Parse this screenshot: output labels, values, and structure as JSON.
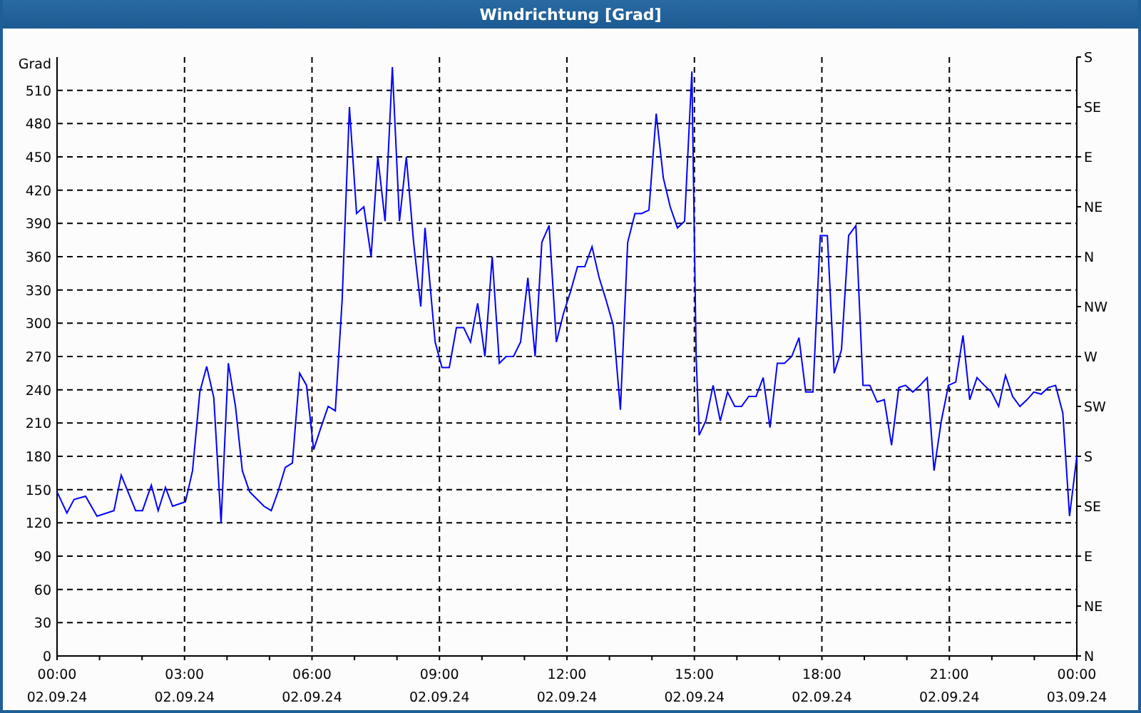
{
  "window": {
    "title": "Windrichtung [Grad]"
  },
  "chart": {
    "chart_data": {
      "type": "line",
      "grid": true,
      "ylabel": "Grad",
      "xlim": [
        0,
        24
      ],
      "ylim": [
        0,
        540
      ],
      "yticks": [
        0,
        30,
        60,
        90,
        120,
        150,
        180,
        210,
        240,
        270,
        300,
        330,
        360,
        390,
        420,
        450,
        480,
        510
      ],
      "xticks": [
        {
          "value": 0,
          "label": "00:00"
        },
        {
          "value": 3,
          "label": "03:00"
        },
        {
          "value": 6,
          "label": "06:00"
        },
        {
          "value": 9,
          "label": "09:00"
        },
        {
          "value": 12,
          "label": "12:00"
        },
        {
          "value": 15,
          "label": "15:00"
        },
        {
          "value": 18,
          "label": "18:00"
        },
        {
          "value": 21,
          "label": "21:00"
        },
        {
          "value": 24,
          "label": "00:00"
        }
      ],
      "x": [
        0,
        0.23,
        0.4,
        0.67,
        0.94,
        1.34,
        1.51,
        1.85,
        2.01,
        2.22,
        2.38,
        2.55,
        2.72,
        3.02,
        3.19,
        3.36,
        3.52,
        3.69,
        3.86,
        4.03,
        4.2,
        4.36,
        4.53,
        4.87,
        5.04,
        5.2,
        5.37,
        5.54,
        5.71,
        5.87,
        6.04,
        6.21,
        6.38,
        6.55,
        6.71,
        6.88,
        7.05,
        7.22,
        7.39,
        7.55,
        7.72,
        7.89,
        8.06,
        8.22,
        8.39,
        8.56,
        8.66,
        8.9,
        9.06,
        9.23,
        9.4,
        9.57,
        9.73,
        9.9,
        10.07,
        10.24,
        10.41,
        10.57,
        10.74,
        10.91,
        11.08,
        11.25,
        11.41,
        11.58,
        11.75,
        11.92,
        12.08,
        12.25,
        12.42,
        12.59,
        12.76,
        12.92,
        13.09,
        13.26,
        13.43,
        13.6,
        13.76,
        13.93,
        14.1,
        14.27,
        14.43,
        14.6,
        14.77,
        14.94,
        15.04,
        15.11,
        15.27,
        15.44,
        15.61,
        15.78,
        15.95,
        16.11,
        16.28,
        16.45,
        16.62,
        16.78,
        16.95,
        17.12,
        17.29,
        17.46,
        17.62,
        17.79,
        17.96,
        18.13,
        18.29,
        18.46,
        18.63,
        18.8,
        18.97,
        19.13,
        19.3,
        19.47,
        19.64,
        19.81,
        19.97,
        20.14,
        20.31,
        20.48,
        20.64,
        20.81,
        20.98,
        21.15,
        21.32,
        21.48,
        21.65,
        21.82,
        21.99,
        22.16,
        22.32,
        22.49,
        22.66,
        22.83,
        22.99,
        23.16,
        23.33,
        23.5,
        23.67,
        23.83,
        24
      ],
      "series": [
        {
          "color": "#0000ff",
          "values": [
            148,
            129,
            141,
            144,
            126,
            131,
            163,
            131,
            131,
            154,
            131,
            152,
            135,
            139,
            167,
            238,
            261,
            233,
            120,
            264,
            225,
            167,
            148,
            135,
            131,
            148,
            170,
            174,
            255,
            244,
            186,
            206,
            225,
            221,
            321,
            495,
            399,
            405,
            360,
            450,
            392,
            531,
            392,
            450,
            373,
            315,
            386,
            283,
            260,
            260,
            296,
            296,
            283,
            318,
            270,
            360,
            264,
            270,
            270,
            283,
            341,
            270,
            373,
            388,
            283,
            309,
            328,
            351,
            351,
            369,
            341,
            321,
            298,
            222,
            373,
            399,
            399,
            402,
            489,
            431,
            405,
            386,
            392,
            527,
            270,
            199,
            212,
            244,
            212,
            238,
            225,
            225,
            234,
            234,
            251,
            206,
            264,
            264,
            270,
            287,
            238,
            238,
            379,
            379,
            255,
            276,
            379,
            388,
            244,
            244,
            229,
            231,
            190,
            242,
            244,
            238,
            244,
            251,
            167,
            212,
            244,
            247,
            289,
            231,
            251,
            244,
            238,
            225,
            253,
            234,
            225,
            231,
            238,
            236,
            242,
            244,
            219,
            126,
            180
          ]
        }
      ]
    },
    "xtick_dates": [
      "02.09.24",
      "02.09.24",
      "02.09.24",
      "02.09.24",
      "02.09.24",
      "02.09.24",
      "02.09.24",
      "02.09.24",
      "03.09.24"
    ],
    "right_axis": [
      "S",
      "SE",
      "E",
      "NE",
      "N",
      "NW",
      "W",
      "SW",
      "S",
      "SE",
      "E",
      "NE",
      "N"
    ]
  }
}
